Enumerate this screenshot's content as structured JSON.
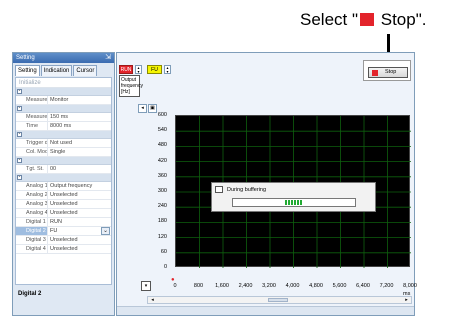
{
  "callout": {
    "text_before": "Select \"",
    "text_after": " Stop\"."
  },
  "panel": {
    "title": "Setting",
    "tabs": [
      "Setting",
      "Indication",
      "Cursor"
    ],
    "initialize_label": "Initialize",
    "rows_group1": [
      {
        "k": "Measure by",
        "v": "Monitor"
      }
    ],
    "rows_group2": [
      {
        "k": "Measurement",
        "v": "150 ms"
      },
      {
        "k": "Time",
        "v": "8000 ms"
      }
    ],
    "rows_group3": [
      {
        "k": "Trigger data",
        "v": "Not used"
      },
      {
        "k": "Col. Mode",
        "v": "Single"
      }
    ],
    "rows_group4": [
      {
        "k": "Tgt. St.",
        "v": "00"
      }
    ],
    "rows_group5": [
      {
        "k": "Analog 1",
        "v": "Output frequency"
      },
      {
        "k": "Analog 2",
        "v": "Unselected"
      },
      {
        "k": "Analog 3",
        "v": "Unselected"
      },
      {
        "k": "Analog 4",
        "v": "Unselected"
      },
      {
        "k": "Digital 1",
        "v": "RUN"
      },
      {
        "k": "Digital 2",
        "v": "FU"
      },
      {
        "k": "Digital 3",
        "v": "Unselected"
      },
      {
        "k": "Digital 4",
        "v": "Unselected"
      }
    ],
    "footer": "Digital 2"
  },
  "graph": {
    "run_label": "RUN",
    "fu_label": "FU",
    "axis_title": "Output frequency [Hz]",
    "stop_label": "Stop",
    "y_ticks": [
      "600",
      "540",
      "480",
      "420",
      "360",
      "300",
      "240",
      "180",
      "120",
      "60",
      "0"
    ],
    "x_ticks": [
      "0",
      "800",
      "1,600",
      "2,400",
      "3,200",
      "4,000",
      "4,800",
      "5,600",
      "6,400",
      "7,200",
      "8,000"
    ],
    "x_unit": "ms",
    "buffer_message": "During buffering",
    "buffer_progress": 0.14
  },
  "colors": {
    "plot_background": "#000000",
    "grid": "#0e5f0e",
    "stop_red": "#e3242b",
    "fu_yellow": "#f5f500"
  }
}
